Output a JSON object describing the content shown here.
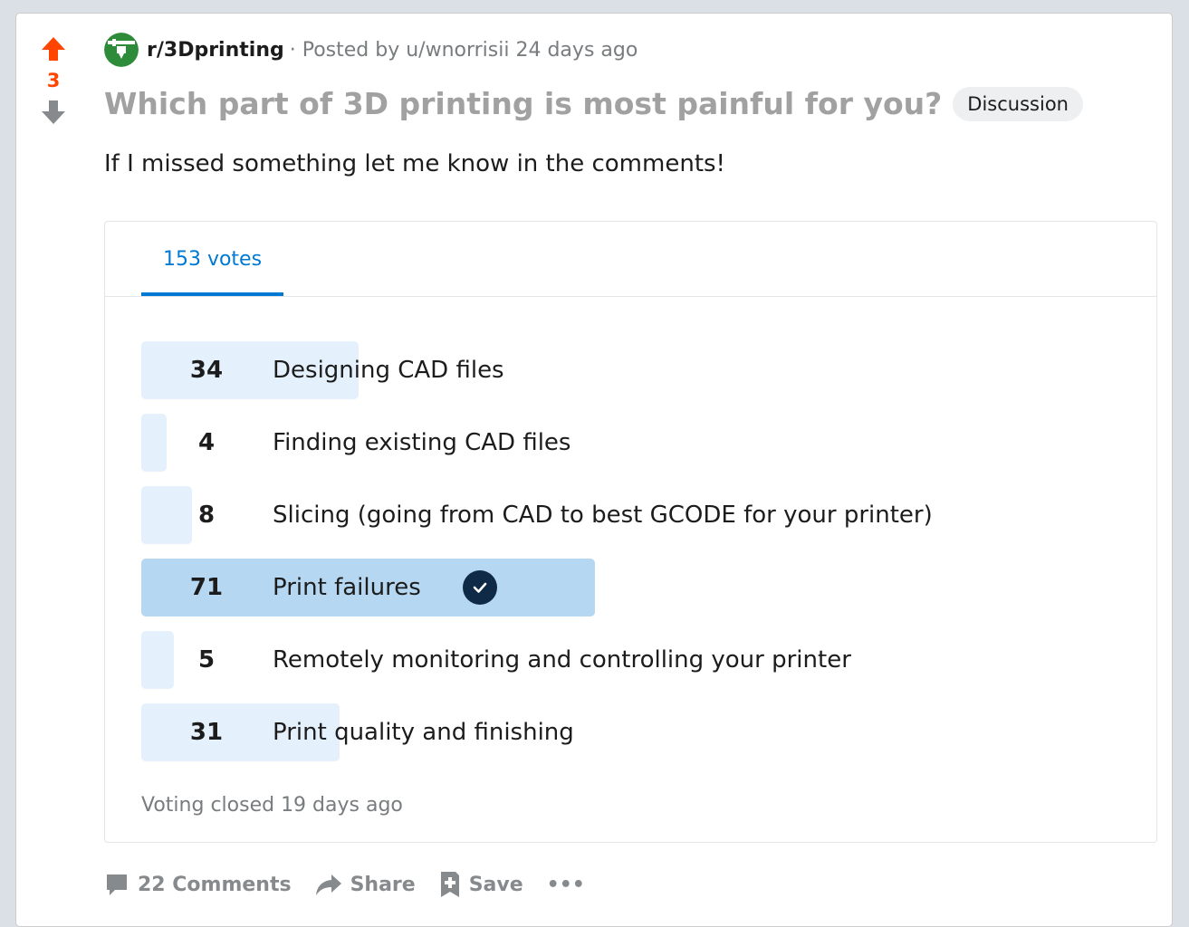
{
  "post": {
    "score": "3",
    "subreddit": "r/3Dprinting",
    "posted_by": "· Posted by u/wnorrisii",
    "age": "24 days ago",
    "title": "Which part of 3D printing is most painful for you?",
    "flair": "Discussion",
    "body": "If I missed something let me know in the comments!"
  },
  "poll": {
    "tab_label": "153 votes",
    "total_votes": 153,
    "options": [
      {
        "count": "34",
        "label": "Designing CAD files",
        "fraction": 0.222
      },
      {
        "count": "4",
        "label": "Finding existing CAD files",
        "fraction": 0.026
      },
      {
        "count": "8",
        "label": "Slicing (going from CAD to best GCODE for your printer)",
        "fraction": 0.052
      },
      {
        "count": "71",
        "label": "Print failures",
        "fraction": 0.464,
        "selected": true
      },
      {
        "count": "5",
        "label": "Remotely monitoring and controlling your printer",
        "fraction": 0.033
      },
      {
        "count": "31",
        "label": "Print quality and finishing",
        "fraction": 0.203
      }
    ],
    "status": "Voting closed 19 days ago"
  },
  "actions": {
    "comments": "22 Comments",
    "share": "Share",
    "save": "Save",
    "more": "•••"
  },
  "colors": {
    "upvote": "#ff4500",
    "bar": "#e4f0fb",
    "bar_selected": "#b6d7f1",
    "accent": "#0079d3"
  },
  "icons": [
    "upvote-arrow-icon",
    "downvote-arrow-icon",
    "subreddit-icon",
    "check-icon",
    "comment-icon",
    "share-icon",
    "save-icon",
    "more-icon"
  ]
}
